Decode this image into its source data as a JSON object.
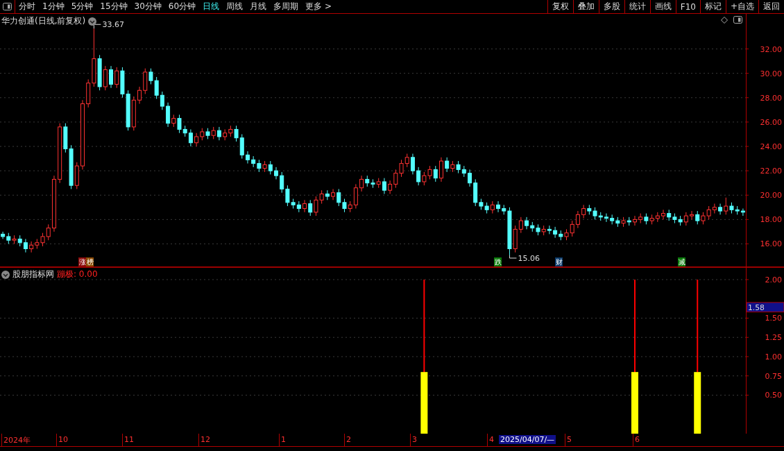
{
  "toolbar": {
    "periods": [
      {
        "label": "分时",
        "selected": false
      },
      {
        "label": "1分钟",
        "selected": false
      },
      {
        "label": "5分钟",
        "selected": false
      },
      {
        "label": "15分钟",
        "selected": false
      },
      {
        "label": "30分钟",
        "selected": false
      },
      {
        "label": "60分钟",
        "selected": false
      },
      {
        "label": "日线",
        "selected": true
      },
      {
        "label": "周线",
        "selected": false
      },
      {
        "label": "月线",
        "selected": false
      },
      {
        "label": "多周期",
        "selected": false
      },
      {
        "label": "更多 >",
        "selected": false
      }
    ],
    "actions": [
      "复权",
      "叠加",
      "多股",
      "统计",
      "画线",
      "F10",
      "标记",
      "+自选",
      "返回"
    ]
  },
  "price_panel": {
    "title": "华力创通(日线,前复权)",
    "chart_data": {
      "type": "candlestick",
      "grid": true,
      "ylim": [
        14.12,
        34.85
      ],
      "yticks": [
        {
          "value": 16,
          "label": "16.00"
        },
        {
          "value": 18,
          "label": "18.00"
        },
        {
          "value": 20,
          "label": "20.00"
        },
        {
          "value": 22,
          "label": "22.00"
        },
        {
          "value": 24,
          "label": "24.00"
        },
        {
          "value": 26,
          "label": "26.00"
        },
        {
          "value": 28,
          "label": "28.00"
        },
        {
          "value": 30,
          "label": "30.00"
        },
        {
          "value": 32,
          "label": "32.00"
        }
      ],
      "ohlc": [
        [
          16.8,
          17.0,
          16.4,
          16.6
        ],
        [
          16.6,
          16.9,
          16.0,
          16.3
        ],
        [
          16.3,
          16.7,
          16.0,
          16.4
        ],
        [
          16.4,
          16.7,
          15.8,
          16.1
        ],
        [
          16.1,
          16.4,
          15.3,
          15.6
        ],
        [
          15.6,
          16.2,
          15.3,
          15.9
        ],
        [
          15.9,
          16.4,
          15.6,
          16.1
        ],
        [
          16.1,
          16.9,
          15.8,
          16.6
        ],
        [
          16.6,
          17.6,
          16.3,
          17.3
        ],
        [
          17.3,
          21.6,
          17.0,
          21.3
        ],
        [
          21.3,
          25.9,
          21.0,
          25.6
        ],
        [
          25.6,
          25.9,
          23.5,
          23.8
        ],
        [
          23.8,
          24.1,
          20.5,
          20.8
        ],
        [
          20.8,
          22.7,
          20.5,
          22.4
        ],
        [
          22.4,
          27.8,
          22.1,
          27.5
        ],
        [
          27.5,
          29.5,
          27.2,
          29.2
        ],
        [
          29.2,
          33.67,
          28.9,
          31.2
        ],
        [
          31.2,
          31.5,
          28.6,
          28.9
        ],
        [
          28.9,
          30.6,
          28.6,
          30.3
        ],
        [
          30.3,
          30.6,
          28.8,
          29.1
        ],
        [
          29.1,
          30.5,
          28.8,
          30.2
        ],
        [
          30.2,
          30.5,
          28.0,
          28.3
        ],
        [
          28.3,
          28.6,
          25.3,
          25.6
        ],
        [
          25.6,
          28.1,
          25.3,
          27.8
        ],
        [
          27.8,
          28.9,
          27.5,
          28.6
        ],
        [
          28.6,
          30.4,
          28.3,
          30.1
        ],
        [
          30.1,
          30.4,
          29.1,
          29.4
        ],
        [
          29.4,
          29.7,
          27.9,
          28.2
        ],
        [
          28.2,
          28.5,
          27.0,
          27.3
        ],
        [
          27.3,
          27.6,
          25.6,
          25.9
        ],
        [
          25.9,
          26.6,
          25.6,
          26.3
        ],
        [
          26.3,
          26.6,
          25.1,
          25.4
        ],
        [
          25.4,
          25.7,
          24.8,
          25.1
        ],
        [
          25.1,
          25.4,
          24.0,
          24.3
        ],
        [
          24.3,
          25.1,
          24.0,
          24.8
        ],
        [
          24.8,
          25.5,
          24.5,
          25.2
        ],
        [
          25.2,
          25.5,
          24.6,
          24.9
        ],
        [
          24.9,
          25.6,
          24.6,
          25.3
        ],
        [
          25.3,
          25.6,
          24.5,
          24.8
        ],
        [
          24.8,
          25.4,
          24.5,
          25.1
        ],
        [
          25.1,
          25.7,
          24.8,
          25.4
        ],
        [
          25.4,
          25.7,
          24.4,
          24.7
        ],
        [
          24.7,
          25.0,
          23.0,
          23.3
        ],
        [
          23.3,
          23.6,
          22.6,
          22.9
        ],
        [
          22.9,
          23.2,
          22.3,
          22.6
        ],
        [
          22.6,
          22.9,
          21.9,
          22.2
        ],
        [
          22.2,
          22.8,
          21.9,
          22.5
        ],
        [
          22.5,
          22.8,
          21.7,
          22.0
        ],
        [
          22.0,
          22.3,
          21.3,
          21.6
        ],
        [
          21.6,
          21.9,
          20.2,
          20.5
        ],
        [
          20.5,
          20.8,
          19.1,
          19.4
        ],
        [
          19.4,
          19.7,
          18.9,
          19.2
        ],
        [
          19.2,
          19.5,
          18.6,
          18.9
        ],
        [
          18.9,
          19.6,
          18.6,
          19.3
        ],
        [
          19.3,
          19.6,
          18.3,
          18.6
        ],
        [
          18.6,
          19.9,
          18.3,
          19.6
        ],
        [
          19.6,
          20.4,
          19.3,
          20.1
        ],
        [
          20.1,
          20.4,
          19.6,
          19.9
        ],
        [
          19.9,
          20.5,
          19.6,
          20.2
        ],
        [
          20.2,
          20.5,
          19.1,
          19.4
        ],
        [
          19.4,
          19.7,
          18.6,
          18.9
        ],
        [
          18.9,
          19.5,
          18.6,
          19.2
        ],
        [
          19.2,
          20.9,
          18.9,
          20.6
        ],
        [
          20.6,
          21.6,
          20.3,
          21.3
        ],
        [
          21.3,
          21.6,
          20.7,
          21.0
        ],
        [
          21.0,
          21.3,
          20.6,
          20.9
        ],
        [
          20.9,
          21.4,
          20.6,
          21.1
        ],
        [
          21.1,
          21.4,
          20.1,
          20.4
        ],
        [
          20.4,
          21.2,
          20.1,
          20.9
        ],
        [
          20.9,
          22.1,
          20.6,
          21.8
        ],
        [
          21.8,
          22.9,
          21.5,
          22.6
        ],
        [
          22.6,
          23.4,
          22.3,
          23.1
        ],
        [
          23.1,
          23.4,
          21.7,
          22.0
        ],
        [
          22.0,
          22.3,
          20.8,
          21.1
        ],
        [
          21.1,
          21.9,
          20.8,
          21.6
        ],
        [
          21.6,
          22.4,
          21.3,
          22.1
        ],
        [
          22.1,
          22.4,
          21.1,
          21.4
        ],
        [
          21.4,
          23.1,
          21.1,
          22.8
        ],
        [
          22.8,
          23.1,
          21.9,
          22.2
        ],
        [
          22.2,
          22.8,
          21.9,
          22.5
        ],
        [
          22.5,
          22.8,
          21.8,
          22.1
        ],
        [
          22.1,
          22.4,
          21.5,
          21.8
        ],
        [
          21.8,
          22.1,
          20.7,
          21.0
        ],
        [
          21.0,
          21.3,
          19.1,
          19.4
        ],
        [
          19.4,
          19.7,
          18.8,
          19.1
        ],
        [
          19.1,
          19.4,
          18.5,
          18.8
        ],
        [
          18.8,
          19.5,
          18.5,
          19.2
        ],
        [
          19.2,
          19.5,
          18.6,
          18.9
        ],
        [
          18.9,
          19.2,
          18.4,
          18.7
        ],
        [
          18.7,
          19.0,
          15.06,
          15.6
        ],
        [
          15.6,
          17.5,
          15.3,
          17.2
        ],
        [
          17.2,
          18.2,
          16.9,
          17.9
        ],
        [
          17.9,
          18.2,
          17.2,
          17.5
        ],
        [
          17.5,
          17.8,
          17.0,
          17.3
        ],
        [
          17.3,
          17.6,
          16.7,
          17.0
        ],
        [
          17.0,
          17.5,
          16.7,
          17.2
        ],
        [
          17.2,
          17.5,
          16.8,
          17.1
        ],
        [
          17.1,
          17.4,
          16.5,
          16.8
        ],
        [
          16.8,
          17.1,
          16.3,
          16.6
        ],
        [
          16.6,
          17.2,
          16.3,
          16.9
        ],
        [
          16.9,
          17.9,
          16.6,
          17.6
        ],
        [
          17.6,
          18.7,
          17.3,
          18.4
        ],
        [
          18.4,
          19.2,
          18.1,
          18.9
        ],
        [
          18.9,
          19.2,
          18.4,
          18.7
        ],
        [
          18.7,
          19.0,
          18.0,
          18.3
        ],
        [
          18.3,
          18.6,
          17.9,
          18.2
        ],
        [
          18.2,
          18.5,
          17.8,
          18.1
        ],
        [
          18.1,
          18.4,
          17.6,
          17.9
        ],
        [
          17.9,
          18.2,
          17.4,
          17.7
        ],
        [
          17.7,
          18.2,
          17.4,
          17.9
        ],
        [
          17.9,
          18.2,
          17.5,
          17.8
        ],
        [
          17.8,
          18.3,
          17.5,
          18.0
        ],
        [
          18.0,
          18.5,
          17.7,
          18.2
        ],
        [
          18.2,
          18.5,
          17.6,
          17.9
        ],
        [
          17.9,
          18.4,
          17.6,
          18.1
        ],
        [
          18.1,
          18.6,
          17.8,
          18.3
        ],
        [
          18.3,
          18.8,
          18.0,
          18.5
        ],
        [
          18.5,
          18.8,
          17.9,
          18.2
        ],
        [
          18.2,
          18.5,
          17.7,
          18.0
        ],
        [
          18.0,
          18.3,
          17.5,
          17.8
        ],
        [
          17.8,
          18.6,
          17.5,
          18.3
        ],
        [
          18.3,
          18.7,
          18.0,
          18.4
        ],
        [
          18.4,
          18.7,
          17.6,
          17.9
        ],
        [
          17.9,
          18.6,
          17.6,
          18.3
        ],
        [
          18.3,
          19.1,
          18.0,
          18.8
        ],
        [
          18.8,
          19.3,
          18.5,
          19.0
        ],
        [
          19.0,
          19.3,
          18.4,
          18.7
        ],
        [
          18.7,
          19.8,
          18.4,
          19.1
        ],
        [
          19.1,
          19.4,
          18.5,
          18.8
        ],
        [
          18.8,
          19.1,
          18.4,
          18.7
        ],
        [
          18.7,
          18.9,
          18.3,
          18.6
        ]
      ],
      "annotations": [
        {
          "text": "33.67"
        },
        {
          "text": "15.06"
        }
      ]
    },
    "events": [
      {
        "text": "涨",
        "color": "#8b0a0a"
      },
      {
        "text": "榜",
        "color": "#8b4a00"
      },
      {
        "text": "跌",
        "color": "#0a7a0a"
      },
      {
        "text": "财",
        "color": "#0a3a6a"
      },
      {
        "text": "减",
        "color": "#0a7a0a"
      }
    ]
  },
  "indicator_panel": {
    "name": "股朋指标网",
    "reading": "蹦极: 0.00",
    "chart_data": {
      "type": "bar",
      "grid": true,
      "ylim": [
        0,
        2.162
      ],
      "yticks": [
        {
          "value": 0.5,
          "label": "0.50"
        },
        {
          "value": 0.75,
          "label": "0.75"
        },
        {
          "value": 1,
          "label": "1.00"
        },
        {
          "value": 1.25,
          "label": "1.25"
        },
        {
          "value": 1.5,
          "label": "1.50"
        },
        {
          "value": 2,
          "label": "2.00"
        }
      ],
      "series": [
        {
          "color": "#ff0000",
          "values": [
            null,
            null,
            null,
            null,
            null,
            null,
            null,
            null,
            null,
            null,
            null,
            null,
            null,
            null,
            null,
            null,
            null,
            null,
            null,
            null,
            null,
            null,
            null,
            null,
            null,
            null,
            null,
            null,
            null,
            null,
            null,
            null,
            null,
            null,
            null,
            null,
            null,
            null,
            null,
            null,
            null,
            null,
            null,
            null,
            null,
            null,
            null,
            null,
            null,
            null,
            null,
            null,
            null,
            null,
            null,
            null,
            null,
            null,
            null,
            null,
            null,
            null,
            null,
            null,
            null,
            null,
            null,
            null,
            null,
            null,
            null,
            null,
            null,
            null,
            2,
            null,
            null,
            null,
            null,
            null,
            null,
            null,
            null,
            null,
            null,
            null,
            null,
            null,
            null,
            null,
            null,
            null,
            null,
            null,
            null,
            null,
            null,
            null,
            null,
            null,
            null,
            null,
            null,
            null,
            null,
            null,
            null,
            null,
            null,
            null,
            null,
            2,
            null,
            null,
            null,
            null,
            null,
            null,
            null,
            null,
            null,
            null,
            2,
            null,
            null,
            null,
            null,
            null,
            null,
            null,
            null
          ]
        },
        {
          "color": "#ffff00",
          "values": [
            null,
            null,
            null,
            null,
            null,
            null,
            null,
            null,
            null,
            null,
            null,
            null,
            null,
            null,
            null,
            null,
            null,
            null,
            null,
            null,
            null,
            null,
            null,
            null,
            null,
            null,
            null,
            null,
            null,
            null,
            null,
            null,
            null,
            null,
            null,
            null,
            null,
            null,
            null,
            null,
            null,
            null,
            null,
            null,
            null,
            null,
            null,
            null,
            null,
            null,
            null,
            null,
            null,
            null,
            null,
            null,
            null,
            null,
            null,
            null,
            null,
            null,
            null,
            null,
            null,
            null,
            null,
            null,
            null,
            null,
            null,
            null,
            null,
            null,
            0.8,
            null,
            null,
            null,
            null,
            null,
            null,
            null,
            null,
            null,
            null,
            null,
            null,
            null,
            null,
            null,
            null,
            null,
            null,
            null,
            null,
            null,
            null,
            null,
            null,
            null,
            null,
            null,
            null,
            null,
            null,
            null,
            null,
            null,
            null,
            null,
            null,
            0.8,
            null,
            null,
            null,
            null,
            null,
            null,
            null,
            null,
            null,
            null,
            0.8,
            null,
            null,
            null,
            null,
            null,
            null,
            null,
            null
          ]
        }
      ]
    },
    "crosshair_value": "1.58"
  },
  "date_axis": [
    {
      "text": "2024年",
      "selected": false
    },
    {
      "text": "10",
      "selected": false
    },
    {
      "text": "11",
      "selected": false
    },
    {
      "text": "12",
      "selected": false
    },
    {
      "text": "1",
      "selected": false
    },
    {
      "text": "2",
      "selected": false
    },
    {
      "text": "3",
      "selected": false
    },
    {
      "text": "4",
      "selected": false
    },
    {
      "text": "2025/04/07/—",
      "selected": true
    },
    {
      "text": "5",
      "selected": false
    },
    {
      "text": "6",
      "selected": false
    }
  ]
}
